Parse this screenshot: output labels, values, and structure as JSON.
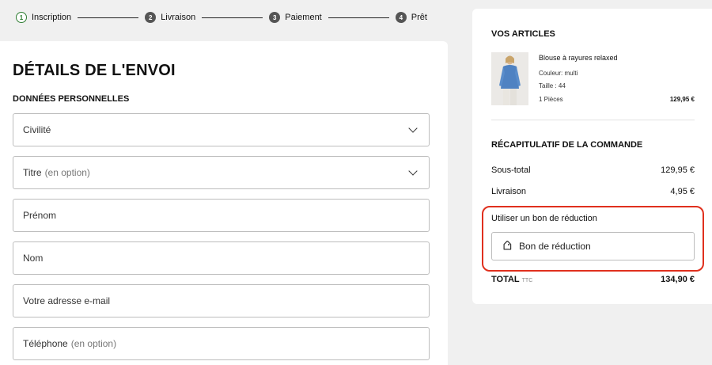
{
  "stepper": {
    "steps": [
      {
        "num": "1",
        "label": "Inscription",
        "state": "active"
      },
      {
        "num": "2",
        "label": "Livraison",
        "state": "inactive"
      },
      {
        "num": "3",
        "label": "Paiement",
        "state": "inactive"
      },
      {
        "num": "4",
        "label": "Prêt",
        "state": "inactive"
      }
    ]
  },
  "shipping": {
    "title": "DÉTAILS DE L'ENVOI",
    "section_title": "DONNÉES PERSONNELLES",
    "fields": {
      "civilite": {
        "label": "Civilité",
        "optional": ""
      },
      "titre": {
        "label": "Titre",
        "optional": "(en option)"
      },
      "prenom": {
        "label": "Prénom",
        "optional": ""
      },
      "nom": {
        "label": "Nom",
        "optional": ""
      },
      "email": {
        "label": "Votre adresse e-mail",
        "optional": ""
      },
      "telephone": {
        "label": "Téléphone",
        "optional": "(en option)"
      }
    }
  },
  "cart": {
    "title": "VOS ARTICLES",
    "item": {
      "name": "Blouse à rayures relaxed",
      "color": "Couleur: multi",
      "size": "Taille : 44",
      "qty": "1 Pièces",
      "price": "129,95 €"
    }
  },
  "summary": {
    "title": "RÉCAPITULATIF DE LA COMMANDE",
    "subtotal_label": "Sous-total",
    "subtotal_value": "129,95 €",
    "shipping_label": "Livraison",
    "shipping_value": "4,95 €",
    "voucher_label": "Utiliser un bon de réduction",
    "voucher_placeholder": "Bon de réduction",
    "total_label": "TOTAL",
    "total_suffix": "TTC",
    "total_value": "134,90 €"
  },
  "colors": {
    "highlight": "#e0301e",
    "active_step": "#2e7d32"
  }
}
